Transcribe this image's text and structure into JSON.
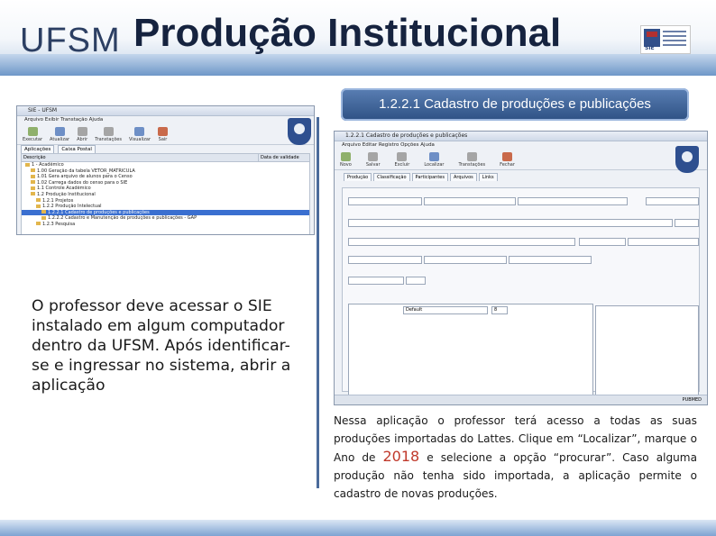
{
  "header": {
    "logo_text": "UFSM",
    "title": "Produção Institucional",
    "sie_logo_text": "SIE"
  },
  "subtitle": "1.2.2.1 Cadastro de produções e publicações",
  "left_text": "O professor deve acessar o SIE instalado em algum computador dentro da UFSM. Após identificar-se e ingressar no sistema, abrir a aplicação",
  "right_text": {
    "part1": "Nessa aplicação o professor terá acesso a todas as suas produções importadas do Lattes. Clique em “Localizar”, marque o Ano de ",
    "year": "2018",
    "part2": " e selecione a opção “procurar”. Caso alguma produção não tenha sido importada, a aplicação permite o cadastro de novas produções."
  },
  "sie_window": {
    "title": "SIE - UFSM",
    "menu": "Arquivo  Exibir  Transtação  Ajuda",
    "toolbar": [
      "Executar",
      "Atualizar",
      "Abrir",
      "Transtações",
      "Visualizar",
      "Sair"
    ],
    "tabs": [
      "Aplicações",
      "Caixa Postal"
    ],
    "columns": [
      "Descrição",
      "Data de validade"
    ],
    "tree": [
      "1 - Acadêmico",
      "1.00 Geração da tabela VETOR_MATRICULA",
      "1.01 Gera arquivo de alunos para o Censo",
      "1.02 Carrega dados do censo para o SIE",
      "1.1 Controle Acadêmico",
      "1.2 Produção Institucional",
      "1.2.1 Projetos",
      "1.2.2 Produção Intelectual",
      "1.2.2.1 Cadastro de produções e publicações",
      "1.2.2.2 Cadastro e Manutenção de produções e publicações - GAP",
      "1.2.3 Pesquisa"
    ],
    "selected_index": 8
  },
  "form_window": {
    "title": "1.2.2.1 Cadastro de produções e publicações",
    "menu": "Arquivo  Editar  Registro  Opções  Ajuda",
    "toolbar": [
      "Novo",
      "Salvar",
      "Excluir",
      "Localizar",
      "Transtações",
      "Fechar"
    ],
    "tabs": [
      "Produção",
      "Classificação",
      "Participantes",
      "Arquivos",
      "Links"
    ],
    "font_value": "Default",
    "font_size": "8",
    "status": "PUBMED"
  }
}
